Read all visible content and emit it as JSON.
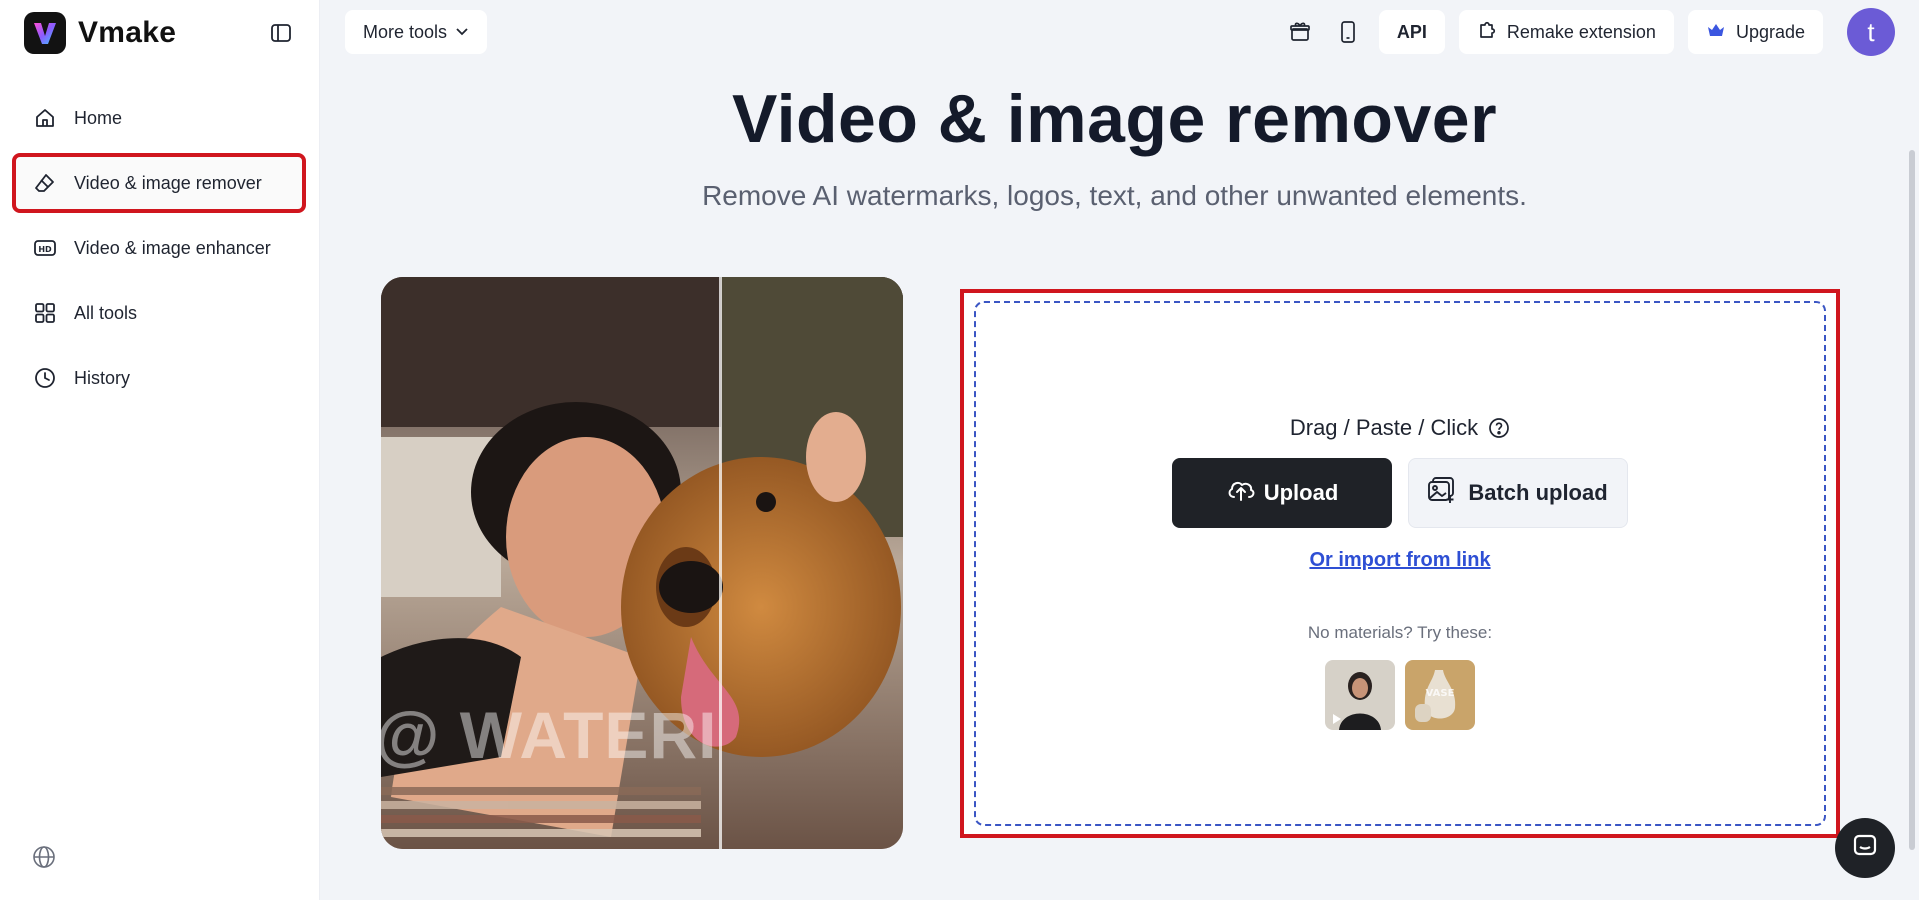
{
  "brand": {
    "name": "Vmake"
  },
  "sidebar": {
    "items": [
      {
        "label": "Home",
        "icon": "home-icon"
      },
      {
        "label": "Video & image remover",
        "icon": "eraser-icon",
        "active": true
      },
      {
        "label": "Video & image enhancer",
        "icon": "hd-icon"
      },
      {
        "label": "All tools",
        "icon": "grid-icon"
      },
      {
        "label": "History",
        "icon": "clock-icon"
      }
    ]
  },
  "topbar": {
    "more_tools": "More tools",
    "api": "API",
    "remake_extension": "Remake extension",
    "upgrade": "Upgrade",
    "avatar_initial": "t"
  },
  "hero": {
    "title": "Video & image remover",
    "subtitle": "Remove AI watermarks, logos, text, and other unwanted elements."
  },
  "demo": {
    "watermark_text": "@ WATERI"
  },
  "upload": {
    "drag_text": "Drag / Paste / Click",
    "upload_label": "Upload",
    "batch_label": "Batch upload",
    "import_link": "Or import from link",
    "samples_label": "No materials? Try these:"
  },
  "colors": {
    "accent": "#d0161e",
    "link": "#2e4fd4",
    "dark_button": "#1f2227",
    "avatar": "#6b5bd6"
  }
}
